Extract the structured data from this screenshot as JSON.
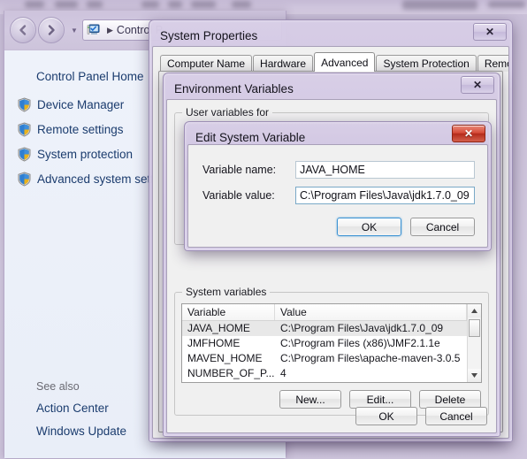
{
  "desktop": {
    "taskbar_note": ""
  },
  "control_panel": {
    "window_name": "Control Panel",
    "address": {
      "text": "Control P",
      "separator": "▸",
      "icon": "computer-icon"
    },
    "nav": {
      "back": "back-arrow-icon",
      "forward": "forward-arrow-icon",
      "history": "history-dropdown-icon"
    },
    "home_link": "Control Panel Home",
    "links": [
      {
        "label": "Device Manager",
        "icon": "shield-icon"
      },
      {
        "label": "Remote settings",
        "icon": "shield-icon"
      },
      {
        "label": "System protection",
        "icon": "shield-icon"
      },
      {
        "label": "Advanced system setting",
        "icon": "shield-icon"
      }
    ],
    "see_also_title": "See also",
    "see_also_links": [
      {
        "label": "Action Center"
      },
      {
        "label": "Windows Update"
      }
    ]
  },
  "system_properties": {
    "title": "System Properties",
    "close_label": "✕",
    "tabs": [
      {
        "label": "Computer Name",
        "active": false
      },
      {
        "label": "Hardware",
        "active": false
      },
      {
        "label": "Advanced",
        "active": true
      },
      {
        "label": "System Protection",
        "active": false
      },
      {
        "label": "Remote",
        "active": false
      }
    ],
    "buttons": {
      "ok": "OK",
      "cancel": "Cancel"
    }
  },
  "environment_variables": {
    "title": "Environment Variables",
    "close_label": "✕",
    "user_group_label": "User variables for",
    "system_group_label": "System variables",
    "table": {
      "columns": [
        "Variable",
        "Value"
      ],
      "rows": [
        {
          "variable": "JAVA_HOME",
          "value": "C:\\Program Files\\Java\\jdk1.7.0_09",
          "selected": true
        },
        {
          "variable": "JMFHOME",
          "value": "C:\\Program Files (x86)\\JMF2.1.1e",
          "selected": false
        },
        {
          "variable": "MAVEN_HOME",
          "value": "C:\\Program Files\\apache-maven-3.0.5",
          "selected": false
        },
        {
          "variable": "NUMBER_OF_P...",
          "value": "4",
          "selected": false
        }
      ]
    },
    "scrollbar": {
      "up": "▲",
      "down": "▼"
    },
    "buttons": {
      "new": "New...",
      "edit": "Edit...",
      "delete": "Delete",
      "ok": "OK",
      "cancel": "Cancel"
    }
  },
  "edit_system_variable": {
    "title": "Edit System Variable",
    "close_label": "✕",
    "name_label": "Variable name:",
    "name_value": "JAVA_HOME",
    "value_label": "Variable value:",
    "value_value": "C:\\Program Files\\Java\\jdk1.7.0_09",
    "buttons": {
      "ok": "OK",
      "cancel": "Cancel"
    }
  },
  "colors": {
    "aero_glass": "#cdc3dc",
    "link_blue": "#1b3c6e",
    "close_red": "#d64a38",
    "default_btn_focus": "#3c93d4",
    "selection_gray": "#e8e8e8"
  }
}
